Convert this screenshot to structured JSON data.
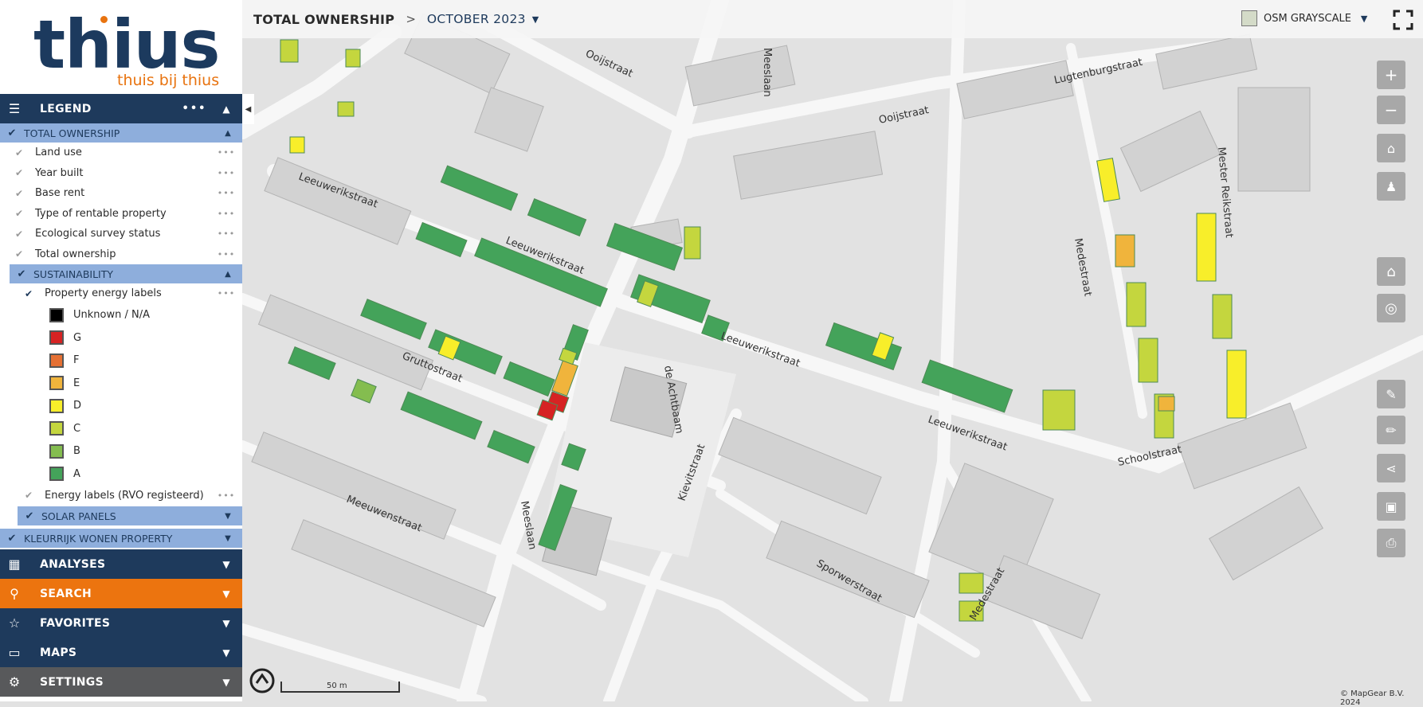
{
  "logo": {
    "word": "thius",
    "tagline": "thuis bij thius"
  },
  "legend_header": {
    "label": "LEGEND"
  },
  "groups": {
    "total_ownership": {
      "label": "TOTAL OWNERSHIP",
      "items": [
        "Land use",
        "Year built",
        "Base rent",
        "Type of rentable property",
        "Ecological survey status",
        "Total ownership"
      ]
    },
    "sustainability": {
      "label": "SUSTAINABILITY",
      "layer": "Property energy labels",
      "labels": [
        {
          "name": "Unknown / N/A",
          "color": "#000000"
        },
        {
          "name": "G",
          "color": "#d62323"
        },
        {
          "name": "F",
          "color": "#e57033"
        },
        {
          "name": "E",
          "color": "#f0b43c"
        },
        {
          "name": "D",
          "color": "#f8ee2a"
        },
        {
          "name": "C",
          "color": "#c4d63e"
        },
        {
          "name": "B",
          "color": "#84bd4f"
        },
        {
          "name": "A",
          "color": "#44a35a"
        }
      ],
      "rvo": "Energy labels (RVO registeerd)"
    },
    "solar_panels": {
      "label": "SOLAR PANELS"
    },
    "kleurrijk": {
      "label": "KLEURRIJK WONEN PROPERTY"
    }
  },
  "nav": {
    "analyses": "ANALYSES",
    "search": "SEARCH",
    "favorites": "FAVORITES",
    "maps": "MAPS",
    "settings": "SETTINGS"
  },
  "topbar": {
    "crumb1": "TOTAL OWNERSHIP",
    "sep": ">",
    "crumb2": "OCTOBER 2023",
    "basemap": "OSM GRAYSCALE"
  },
  "streets": {
    "ooijstraat": "Ooijstraat",
    "leeuwerik": "Leeuwerikstraat",
    "meeslaan": "Meeslaan",
    "lugtenburg": "Lugtenburgstraat",
    "mester": "Mester Reikstraat",
    "medede": "Medestraat",
    "schoolstraat": "Schoolstraat",
    "gruttostraat": "Gruttostraat",
    "meeuwen": "Meeuwenstraat",
    "kievit": "Kievitstraat",
    "sporwer": "Sporwerstraat",
    "acht": "de Achtbaam"
  },
  "map": {
    "scale": "50 m",
    "copyright": "© MapGear B.V. 2024"
  }
}
